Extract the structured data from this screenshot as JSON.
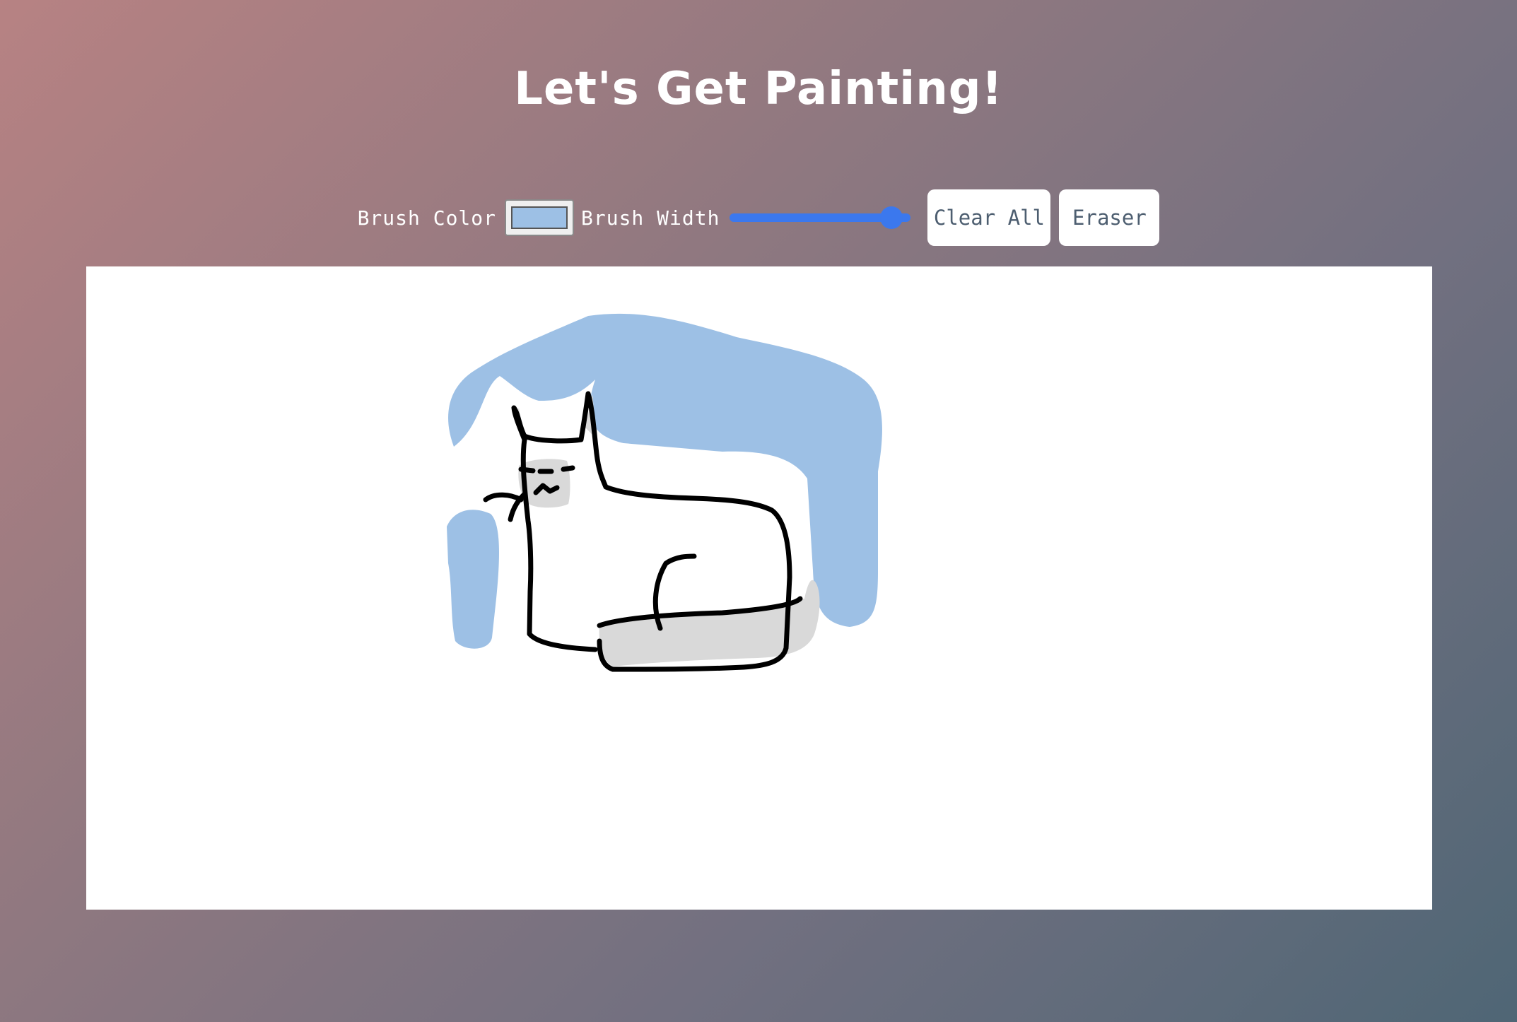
{
  "header": {
    "title": "Let's Get Painting!"
  },
  "toolbar": {
    "brush_color_label": "Brush Color",
    "brush_color_value": "#9dc0e5",
    "brush_width_label": "Brush Width",
    "brush_width_level": 0.95,
    "clear_all_label": "Clear All",
    "eraser_label": "Eraser"
  },
  "canvas": {
    "background": "#ffffff",
    "drawing_colors": {
      "blue": "#9dc0e5",
      "black": "#000000",
      "gray": "#d9d9d9"
    }
  },
  "colors": {
    "slider_accent": "#3b78ee",
    "button_text": "#4d5e70"
  }
}
